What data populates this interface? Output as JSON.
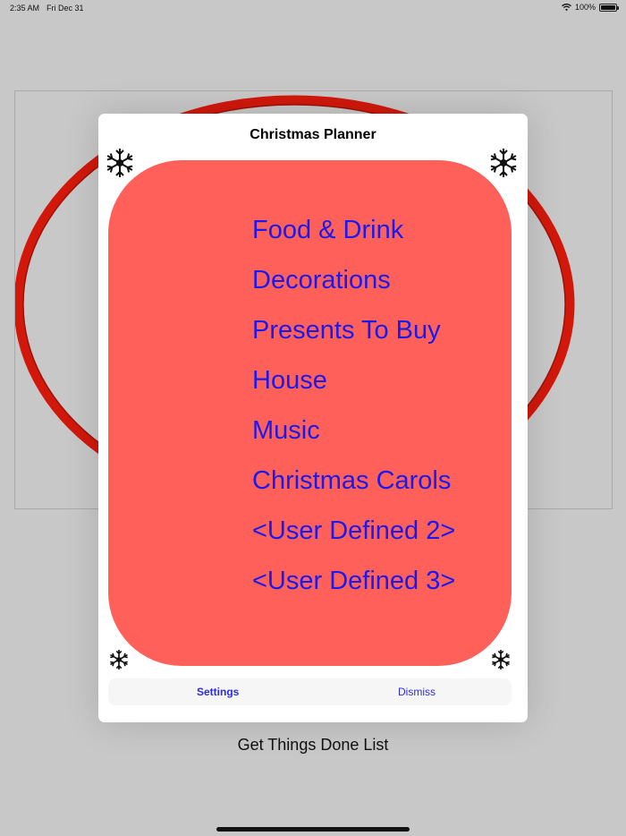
{
  "status_bar": {
    "time": "2:35 AM",
    "date": "Fri Dec 31",
    "battery": "100%",
    "battery_level": 1.0
  },
  "background": {
    "caption": "Get Things Done List",
    "ring_color": "#cc1100"
  },
  "modal": {
    "title": "Christmas Planner",
    "card_color": "#ff615a",
    "link_color": "#1a1aee",
    "menu_items": [
      "Food & Drink",
      "Decorations",
      "Presents To Buy",
      "House",
      "Music",
      "Christmas Carols",
      "<User Defined 2>",
      "<User Defined 3>"
    ],
    "tabs": {
      "settings": "Settings",
      "dismiss": "Dismiss"
    },
    "icons": [
      "snowflake-icon"
    ]
  }
}
